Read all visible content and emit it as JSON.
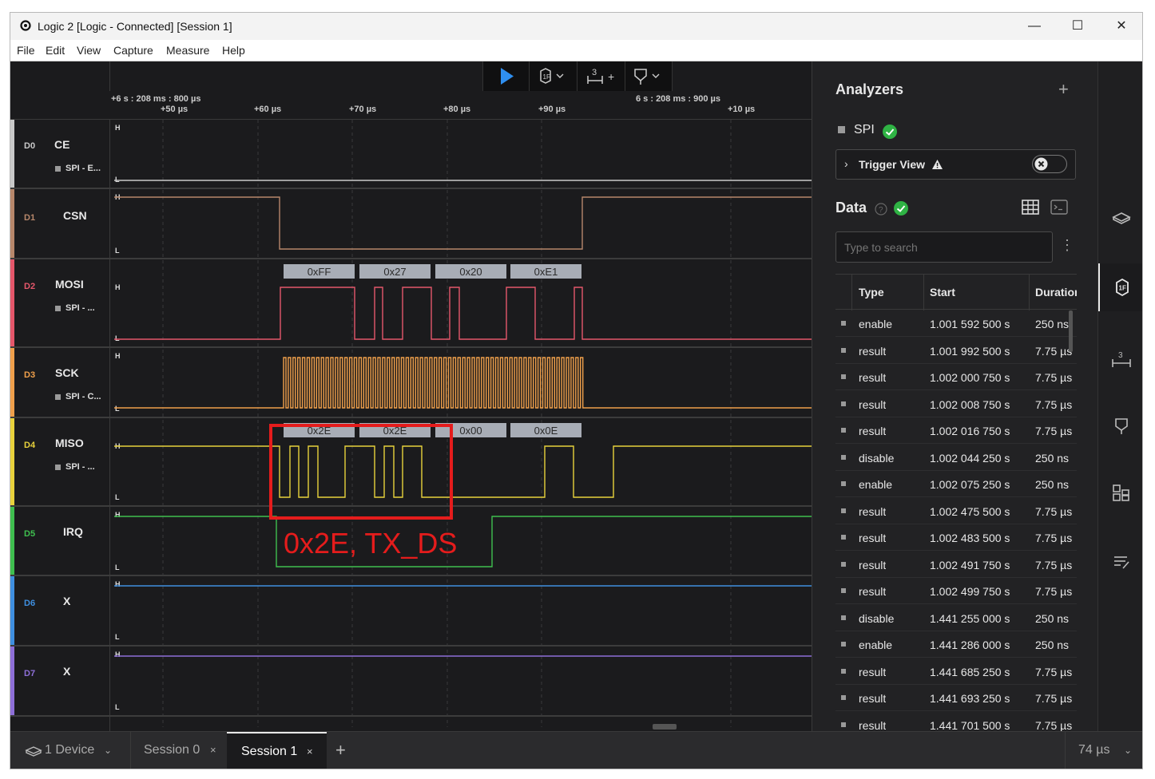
{
  "window": {
    "title": "Logic 2 [Logic - Connected] [Session 1]",
    "controls": [
      "—",
      "☐",
      "✕"
    ]
  },
  "menu": [
    "File",
    "Edit",
    "View",
    "Capture",
    "Measure",
    "Help"
  ],
  "toolbar": {
    "play_icon": "play-icon",
    "analyzer_icon": "analyzer-icon",
    "measure_label": "3",
    "trigger_icon": "trigger-icon"
  },
  "ruler": {
    "left_anchor": "+6 s : 208 ms : 800 µs",
    "right_anchor": "6 s : 208 ms : 900 µs",
    "ticks": [
      "+50 µs",
      "+60 µs",
      "+70 µs",
      "+80 µs",
      "+90 µs",
      "+10 µs"
    ]
  },
  "channels": [
    {
      "idx": "D0",
      "name": "CE",
      "sub": "SPI - E...",
      "color": "#c9c9c9"
    },
    {
      "idx": "D1",
      "name": "CSN",
      "sub": "",
      "color": "#b7876b"
    },
    {
      "idx": "D2",
      "name": "MOSI",
      "sub": "SPI - ...",
      "color": "#e5576b"
    },
    {
      "idx": "D3",
      "name": "SCK",
      "sub": "SPI - C...",
      "color": "#f0a04b"
    },
    {
      "idx": "D4",
      "name": "MISO",
      "sub": "SPI - ...",
      "color": "#e8d23c"
    },
    {
      "idx": "D5",
      "name": "IRQ",
      "sub": "",
      "color": "#3fbf4f"
    },
    {
      "idx": "D6",
      "name": "X",
      "sub": "",
      "color": "#3f8fe0"
    },
    {
      "idx": "D7",
      "name": "X",
      "sub": "",
      "color": "#8e6fd8"
    }
  ],
  "levels": {
    "high": "H",
    "low": "L"
  },
  "mosi_bytes": [
    "0xFF",
    "0x27",
    "0x20",
    "0xE1"
  ],
  "miso_bytes": [
    "0x2E",
    "0x2E",
    "0x00",
    "0x0E"
  ],
  "annotation": {
    "text": "0x2E, TX_DS",
    "color": "#e51c1c"
  },
  "analyzers": {
    "heading": "Analyzers",
    "add": "+",
    "spi_label": "SPI",
    "trigger_view": "Trigger View",
    "data_heading": "Data",
    "search_placeholder": "Type to search",
    "columns": [
      "Type",
      "Start",
      "Duration"
    ],
    "rows": [
      [
        "enable",
        "1.001 592 500 s",
        "250 ns"
      ],
      [
        "result",
        "1.001 992 500 s",
        "7.75 µs"
      ],
      [
        "result",
        "1.002 000 750 s",
        "7.75 µs"
      ],
      [
        "result",
        "1.002 008 750 s",
        "7.75 µs"
      ],
      [
        "result",
        "1.002 016 750 s",
        "7.75 µs"
      ],
      [
        "disable",
        "1.002 044 250 s",
        "250 ns"
      ],
      [
        "enable",
        "1.002 075 250 s",
        "250 ns"
      ],
      [
        "result",
        "1.002 475 500 s",
        "7.75 µs"
      ],
      [
        "result",
        "1.002 483 500 s",
        "7.75 µs"
      ],
      [
        "result",
        "1.002 491 750 s",
        "7.75 µs"
      ],
      [
        "result",
        "1.002 499 750 s",
        "7.75 µs"
      ],
      [
        "disable",
        "1.441 255 000 s",
        "250 ns"
      ],
      [
        "enable",
        "1.441 286 000 s",
        "250 ns"
      ],
      [
        "result",
        "1.441 685 250 s",
        "7.75 µs"
      ],
      [
        "result",
        "1.441 693 250 s",
        "7.75 µs"
      ],
      [
        "result",
        "1.441 701 500 s",
        "7.75 µs"
      ]
    ]
  },
  "statusbar": {
    "device": "1 Device",
    "tabs": [
      "Session 0",
      "Session 1"
    ],
    "add_tab": "+",
    "zoom": "74 µs"
  },
  "rnav_icons": [
    "device-icon",
    "analyzers-icon",
    "measure-icon",
    "trigger-icon",
    "extensions-icon",
    "notes-icon"
  ]
}
